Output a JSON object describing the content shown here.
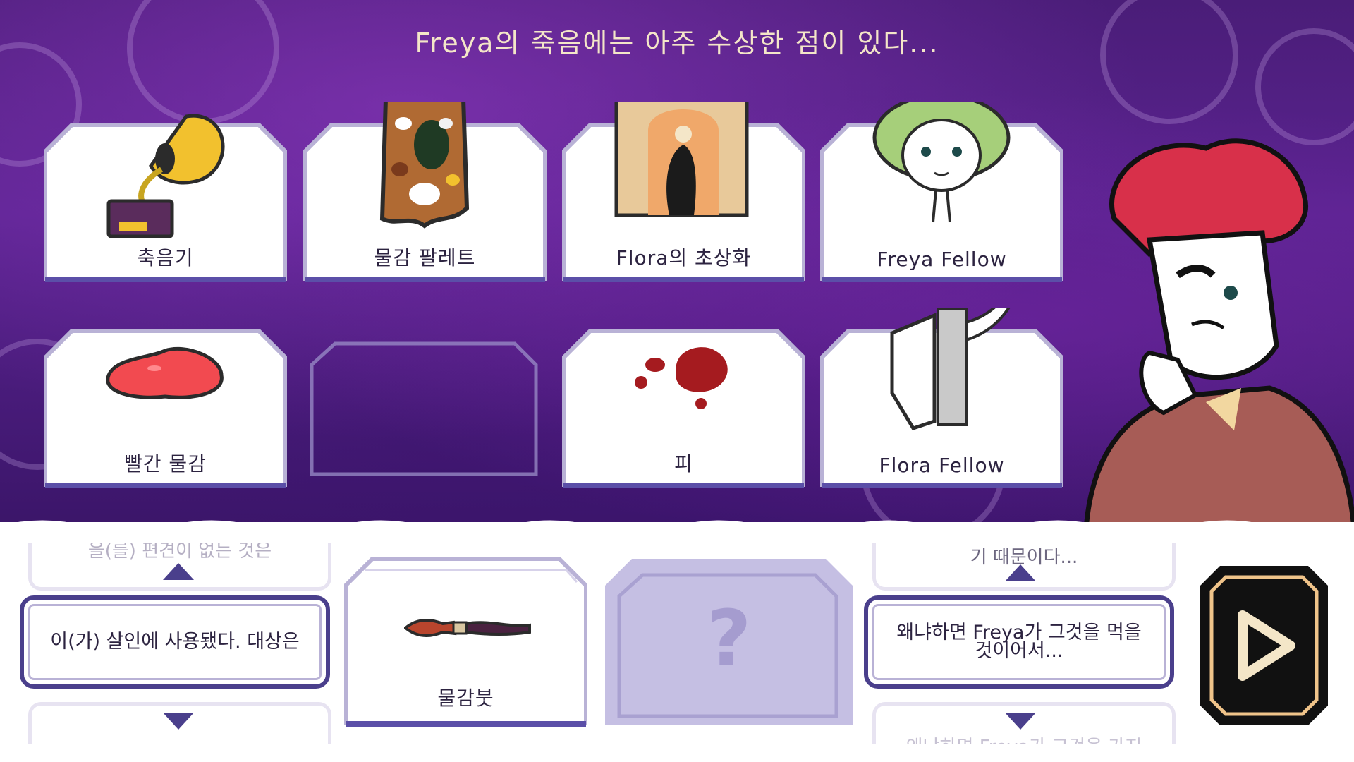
{
  "header": {
    "title": "Freya의 죽음에는 아주 수상한 점이 있다..."
  },
  "evidence_cards": [
    {
      "label": "축음기",
      "icon": "gramophone-icon"
    },
    {
      "label": "물감 팔레트",
      "icon": "paint-palette-icon"
    },
    {
      "label": "Flora의 초상화",
      "icon": "portrait-painting-icon"
    },
    {
      "label": "Freya Fellow",
      "icon": "freya-portrait-icon"
    },
    {
      "label": "빨간 물감",
      "icon": "red-paint-puddle-icon"
    },
    {
      "label": "",
      "icon": "empty-slot"
    },
    {
      "label": "피",
      "icon": "blood-drops-icon"
    },
    {
      "label": "Flora Fellow",
      "icon": "flora-portrait-icon"
    }
  ],
  "deduction": {
    "slot1": {
      "above": "을(를) 편견이 없는 것은",
      "current": "이(가) 살인에 사용됐다. 대상은",
      "below": ""
    },
    "slot2": {
      "label": "물감붓",
      "icon": "paintbrush-icon"
    },
    "slot3": {
      "placeholder": "?"
    },
    "slot4": {
      "above": "기 때문이다...",
      "current": "왜냐하면 Freya가 그것을 먹을 것이어서...",
      "below": "왜냐하면 Freya가 그것을 가지"
    },
    "submit_icon": "play-icon"
  },
  "colors": {
    "card_border": "#b9b2d6",
    "card_underline": "#5b4fa8",
    "text_cream": "#f4e6c8",
    "submit_bg": "#111111",
    "submit_accent": "#f0c48a"
  }
}
